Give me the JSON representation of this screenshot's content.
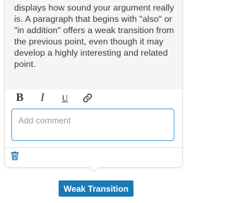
{
  "card": {
    "explanation": "displays how sound your argument really is. A paragraph that begins with \"also\" or \"in addition\" offers a weak transition from the previous point, even though it may develop a highly interesting and related point."
  },
  "toolbar": {
    "bold_label": "B",
    "italic_label": "I",
    "underline_label": "U",
    "link_icon": "link-icon"
  },
  "comment": {
    "placeholder": "Add comment",
    "value": ""
  },
  "footer": {
    "delete_icon": "trash-icon"
  },
  "tag": {
    "label": "Weak Transition",
    "color": "#1a7ab6"
  },
  "colors": {
    "accent": "#4e9fd6",
    "trash": "#1a7ab6",
    "card_bg": "#f5f5f5"
  }
}
